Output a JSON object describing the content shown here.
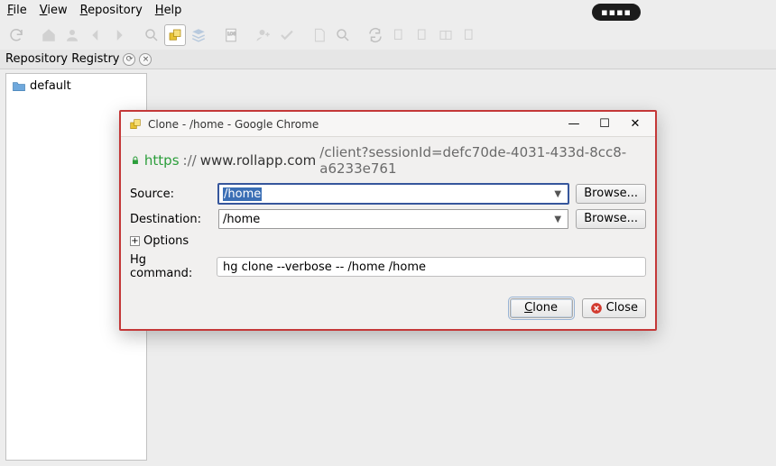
{
  "menubar": {
    "file": "File",
    "view": "View",
    "repository": "Repository",
    "help": "Help"
  },
  "black_pill": "▪▪▪▪",
  "panel": {
    "title": "Repository Registry",
    "reload_glyph": "⟳",
    "close_glyph": "×",
    "tree": {
      "default": "default"
    }
  },
  "dialog": {
    "title": "Clone - /home - Google Chrome",
    "window_controls": {
      "min": "—",
      "max": "☐",
      "close": "✕"
    },
    "address": {
      "scheme": "https",
      "sep": "://",
      "domain": "www.rollapp.com",
      "path": "/client?sessionId=defc70de-4031-433d-8cc8-a6233e761"
    },
    "form": {
      "source_label": "Source:",
      "source_value": "/home",
      "destination_label": "Destination:",
      "destination_value": "/home",
      "browse": "Browse...",
      "options_label": "Options",
      "hg_label": "Hg command:",
      "hg_value": "hg clone --verbose -- /home /home",
      "clone": "Clone",
      "close": "Close"
    }
  }
}
